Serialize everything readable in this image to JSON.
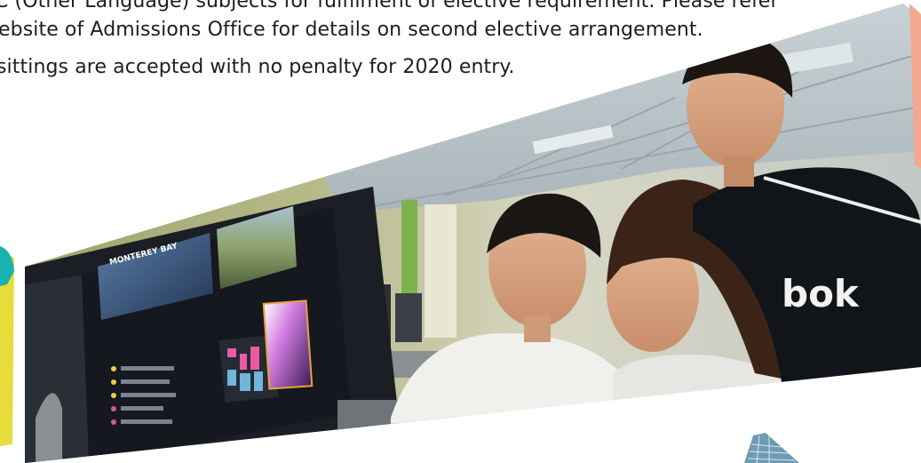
{
  "document": {
    "lines": [
      "C (Other Language) subjects for fulfilment of elective requirement. Please refer",
      "ebsite of Admissions Office for details on second elective arrangement.",
      "sittings are accepted with no penalty for 2020 entry."
    ]
  },
  "photo": {
    "monitor_caption": "MONTEREY BAY",
    "shirt_logo_text": "bok"
  },
  "colors": {
    "text": "#1e1e1e",
    "teal_accent": "#16b3b1",
    "yellow_accent": "#e6dc3a",
    "peach_accent": "#f3a892",
    "screen_dark": "#15181f",
    "shirt_dark": "#111418"
  }
}
